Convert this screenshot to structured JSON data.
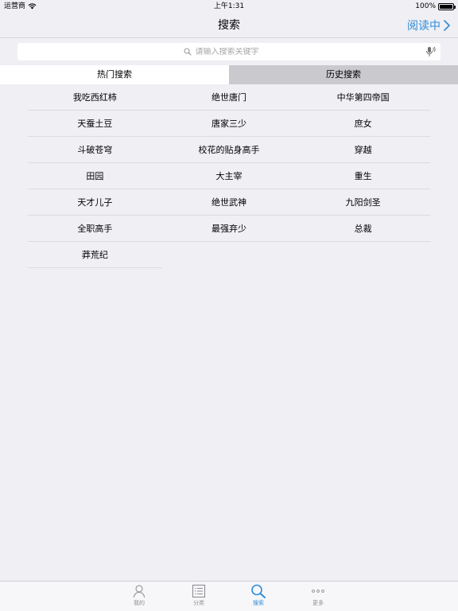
{
  "status": {
    "carrier": "运营商",
    "time": "上午1:31",
    "battery": "100%",
    "battery_level": 1.0
  },
  "nav": {
    "title": "搜索",
    "right_label": "阅读中"
  },
  "search": {
    "placeholder": "请输入搜索关键字",
    "value": ""
  },
  "tabs": {
    "hot": "热门搜索",
    "history": "历史搜索",
    "active": "hot"
  },
  "hot_terms": [
    "我吃西红柿",
    "绝世唐门",
    "中华第四帝国",
    "天蚕土豆",
    "唐家三少",
    "庶女",
    "斗破苍穹",
    "校花的贴身高手",
    "穿越",
    "田园",
    "大主宰",
    "重生",
    "天才儿子",
    "绝世武神",
    "九阳剑圣",
    "全职高手",
    "最强弃少",
    "总裁",
    "莽荒纪"
  ],
  "tab_bar": {
    "mine": "我的",
    "category": "分类",
    "search": "搜索",
    "more": "更多",
    "active": "search"
  },
  "colors": {
    "accent": "#2f8cd8",
    "background": "#efeff4",
    "inactive_tab": "#c9c9ce"
  }
}
